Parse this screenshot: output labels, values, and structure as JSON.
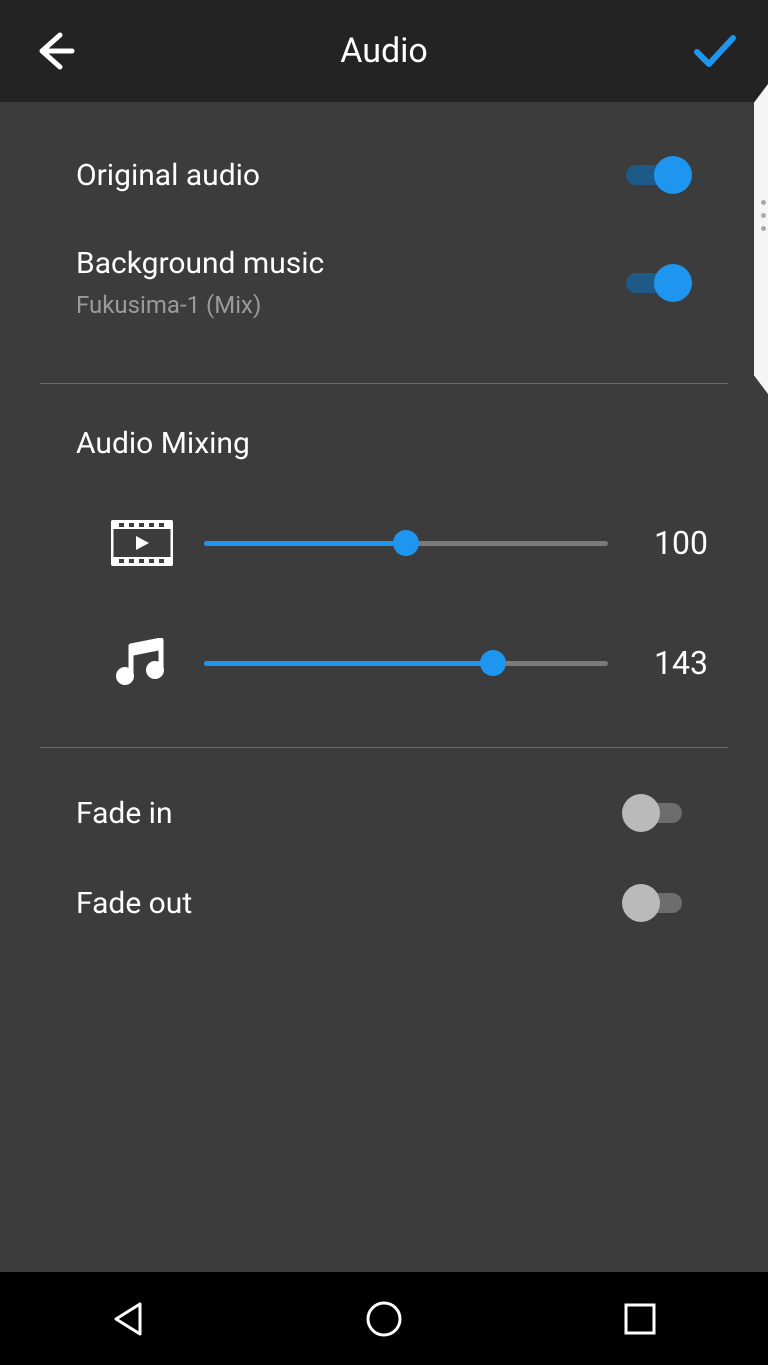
{
  "header": {
    "title": "Audio"
  },
  "toggles": {
    "original_audio": {
      "label": "Original audio",
      "on": true
    },
    "background_music": {
      "label": "Background music",
      "subtitle": "Fukusima-1 (Mix)",
      "on": true
    }
  },
  "mixing": {
    "title": "Audio Mixing",
    "video": {
      "value": 100,
      "max": 200
    },
    "music": {
      "value": 143,
      "max": 200
    }
  },
  "fade": {
    "fade_in": {
      "label": "Fade in",
      "on": false
    },
    "fade_out": {
      "label": "Fade out",
      "on": false
    }
  },
  "colors": {
    "accent": "#1e96f0",
    "bg": "#3c3c3c",
    "header_bg": "#232323"
  }
}
